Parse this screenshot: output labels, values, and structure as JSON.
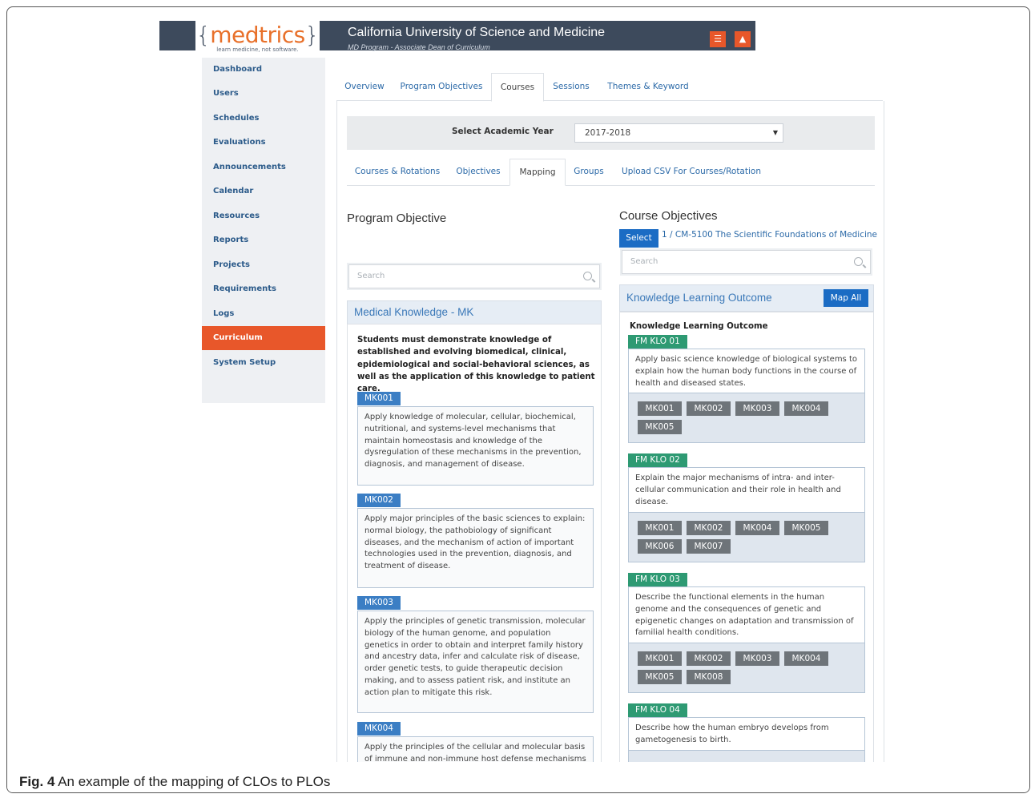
{
  "app": {
    "logo": "medtrics",
    "logo_tagline": "learn medicine, not software.",
    "org_title": "California University of Science and Medicine",
    "org_subtitle": "MD Program - Associate Dean of Curriculum",
    "icons": [
      "list-icon",
      "bell-icon"
    ],
    "accent_color": "#e8572a",
    "brand_dark": "#3d4a5c"
  },
  "sidebar": {
    "items": [
      {
        "label": "Dashboard"
      },
      {
        "label": "Users"
      },
      {
        "label": "Schedules"
      },
      {
        "label": "Evaluations"
      },
      {
        "label": "Announcements"
      },
      {
        "label": "Calendar"
      },
      {
        "label": "Resources"
      },
      {
        "label": "Reports"
      },
      {
        "label": "Projects"
      },
      {
        "label": "Requirements"
      },
      {
        "label": "Logs"
      },
      {
        "label": "Curriculum",
        "active": true
      },
      {
        "label": "System Setup"
      }
    ]
  },
  "tabs": [
    "Overview",
    "Program Objectives",
    "Courses",
    "Sessions",
    "Themes & Keyword"
  ],
  "active_tab": "Courses",
  "year": {
    "label": "Select Academic Year",
    "value": "2017-2018"
  },
  "subtabs": [
    "Courses & Rotations",
    "Objectives",
    "Mapping",
    "Groups",
    "Upload CSV For Courses/Rotation"
  ],
  "active_subtab": "Mapping",
  "program": {
    "heading": "Program Objective",
    "search_placeholder": "Search",
    "section_title": "Medical Knowledge - MK",
    "intro": "Students must demonstrate knowledge of established and evolving biomedical, clinical, epidemiological and social-behavioral sciences, as well as the application of this knowledge to patient care.",
    "objectives": [
      {
        "code": "MK001",
        "text": "Apply knowledge of molecular, cellular, biochemical, nutritional, and systems-level mechanisms that maintain homeostasis and knowledge of the dysregulation of these mechanisms in the prevention, diagnosis, and management of disease."
      },
      {
        "code": "MK002",
        "text": "Apply major principles of the basic sciences to explain: normal biology, the pathobiology of significant diseases, and the mechanism of action of important technologies used in the prevention, diagnosis, and treatment of disease."
      },
      {
        "code": "MK003",
        "text": "Apply the principles of genetic transmission, molecular biology of the human genome, and population genetics in order to obtain and interpret family history and ancestry data, infer and calculate risk of disease, order genetic tests, to guide therapeutic decision making, and to assess patient risk, and institute an action plan to mitigate this risk."
      },
      {
        "code": "MK004",
        "text": "Apply the principles of the cellular and molecular basis of immune and non-immune host defense mechanisms"
      }
    ]
  },
  "course": {
    "heading": "Course Objectives",
    "select_label": "Select",
    "course_name": "1 / CM-5100 The Scientific Foundations of Medicine",
    "search_placeholder": "Search",
    "section_title": "Knowledge Learning Outcome",
    "map_all_label": "Map All",
    "group_label": "Knowledge Learning Outcome",
    "outcomes": [
      {
        "code": "FM KLO 01",
        "text": "Apply basic science knowledge of biological systems to explain how the human body functions in the course of health and diseased states.",
        "mapped": [
          "MK001",
          "MK002",
          "MK003",
          "MK004",
          "MK005"
        ]
      },
      {
        "code": "FM KLO 02",
        "text": "Explain the major mechanisms of intra- and inter-cellular communication and their role in health and disease.",
        "mapped": [
          "MK001",
          "MK002",
          "MK004",
          "MK005",
          "MK006",
          "MK007"
        ]
      },
      {
        "code": "FM KLO 03",
        "text": "Describe the functional elements in the human genome and the consequences of genetic and epigenetic changes on adaptation and transmission of familial health conditions.",
        "mapped": [
          "MK001",
          "MK002",
          "MK003",
          "MK004",
          "MK005",
          "MK008"
        ]
      },
      {
        "code": "FM KLO 04",
        "text": "Describe how the human embryo develops from gametogenesis to birth."
      }
    ]
  },
  "caption": {
    "label": "Fig. 4",
    "text": "An example of the mapping of CLOs to PLOs"
  }
}
